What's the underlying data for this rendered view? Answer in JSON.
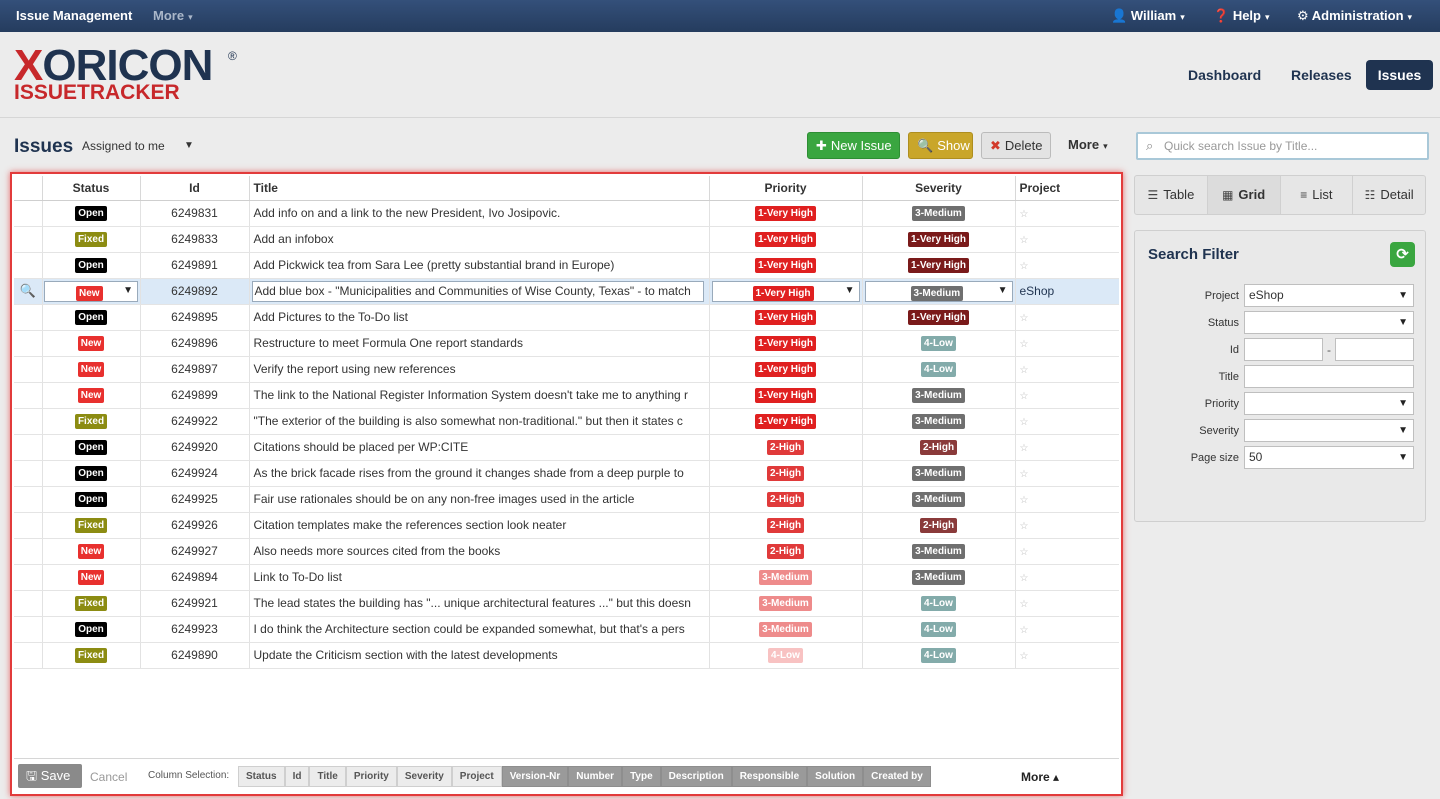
{
  "topbar": {
    "brand": "Issue Management",
    "more": "More",
    "user": "William",
    "help": "Help",
    "admin": "Administration"
  },
  "logo": {
    "line1": "XORICON",
    "line2": "ISSUETRACKER",
    "reg": "®"
  },
  "nav": {
    "dashboard": "Dashboard",
    "releases": "Releases",
    "issues": "Issues"
  },
  "toolbar": {
    "title": "Issues",
    "filter_select": "Assigned to me",
    "new_issue": "New Issue",
    "show": "Show",
    "delete": "Delete",
    "more": "More"
  },
  "search": {
    "placeholder": "Quick search Issue by Title..."
  },
  "grid": {
    "columns": {
      "status": "Status",
      "id": "Id",
      "title": "Title",
      "priority": "Priority",
      "severity": "Severity",
      "project": "Project"
    },
    "rows": [
      {
        "status": "Open",
        "id": "6249831",
        "title": "Add info on and a link to the new President, Ivo Josipovic.",
        "priority": "1-Very High",
        "severity": "3-Medium",
        "project": "☆"
      },
      {
        "status": "Fixed",
        "id": "6249833",
        "title": "Add an infobox",
        "priority": "1-Very High",
        "severity": "1-Very High",
        "project": "☆"
      },
      {
        "status": "Open",
        "id": "6249891",
        "title": "Add Pickwick tea from Sara Lee (pretty substantial brand in Europe)",
        "priority": "1-Very High",
        "severity": "1-Very High",
        "project": "☆"
      },
      {
        "status": "New",
        "id": "6249892",
        "title": "Add blue box - \"Municipalities and Communities of Wise County, Texas\" - to match",
        "priority": "1-Very High",
        "severity": "3-Medium",
        "project": "eShop"
      },
      {
        "status": "Open",
        "id": "6249895",
        "title": "Add Pictures to the To-Do list",
        "priority": "1-Very High",
        "severity": "1-Very High",
        "project": "☆"
      },
      {
        "status": "New",
        "id": "6249896",
        "title": "Restructure to meet Formula One report standards",
        "priority": "1-Very High",
        "severity": "4-Low",
        "project": "☆"
      },
      {
        "status": "New",
        "id": "6249897",
        "title": "Verify the report using new references",
        "priority": "1-Very High",
        "severity": "4-Low",
        "project": "☆"
      },
      {
        "status": "New",
        "id": "6249899",
        "title": "The link to the National Register Information System doesn't take me to anything r",
        "priority": "1-Very High",
        "severity": "3-Medium",
        "project": "☆"
      },
      {
        "status": "Fixed",
        "id": "6249922",
        "title": "\"The exterior of the building is also somewhat non-traditional.\" but then it states c",
        "priority": "1-Very High",
        "severity": "3-Medium",
        "project": "☆"
      },
      {
        "status": "Open",
        "id": "6249920",
        "title": "Citations should be placed per WP:CITE",
        "priority": "2-High",
        "severity": "2-High",
        "project": "☆"
      },
      {
        "status": "Open",
        "id": "6249924",
        "title": "As the brick facade rises from the ground it changes shade from a deep purple to",
        "priority": "2-High",
        "severity": "3-Medium",
        "project": "☆"
      },
      {
        "status": "Open",
        "id": "6249925",
        "title": "Fair use rationales should be on any non-free images used in the article",
        "priority": "2-High",
        "severity": "3-Medium",
        "project": "☆"
      },
      {
        "status": "Fixed",
        "id": "6249926",
        "title": "Citation templates make the references section look neater",
        "priority": "2-High",
        "severity": "2-High",
        "project": "☆"
      },
      {
        "status": "New",
        "id": "6249927",
        "title": "Also needs more sources cited from the books",
        "priority": "2-High",
        "severity": "3-Medium",
        "project": "☆"
      },
      {
        "status": "New",
        "id": "6249894",
        "title": "Link to To-Do list",
        "priority": "3-Medium",
        "severity": "3-Medium",
        "project": "☆"
      },
      {
        "status": "Fixed",
        "id": "6249921",
        "title": "The lead states the building has \"... unique architectural features ...\" but this doesn",
        "priority": "3-Medium",
        "severity": "4-Low",
        "project": "☆"
      },
      {
        "status": "Open",
        "id": "6249923",
        "title": "I do think the Architecture section could be expanded somewhat, but that's a pers",
        "priority": "3-Medium",
        "severity": "4-Low",
        "project": "☆"
      },
      {
        "status": "Fixed",
        "id": "6249890",
        "title": "Update the Criticism section with the latest developments",
        "priority": "4-Low",
        "severity": "4-Low",
        "project": "☆"
      }
    ]
  },
  "footer": {
    "save": "Save",
    "cancel": "Cancel",
    "column_selection": "Column Selection:",
    "columns": [
      "Status",
      "Id",
      "Title",
      "Priority",
      "Severity",
      "Project",
      "Version-Nr",
      "Number",
      "Type",
      "Description",
      "Responsible",
      "Solution",
      "Created by"
    ],
    "more": "More"
  },
  "views": {
    "table": "Table",
    "grid": "Grid",
    "list": "List",
    "detail": "Detail"
  },
  "filter": {
    "title": "Search Filter",
    "labels": {
      "project": "Project",
      "status": "Status",
      "id": "Id",
      "title": "Title",
      "priority": "Priority",
      "severity": "Severity",
      "page_size": "Page size"
    },
    "values": {
      "project": "eShop",
      "status": "",
      "id_from": "",
      "id_to": "",
      "title": "",
      "priority": "",
      "severity": "",
      "page_size": "50"
    }
  },
  "colors": {
    "accent": "#1f3350",
    "brand_red": "#c7282b",
    "new_button": "#3aa640",
    "show_button": "#c9a62a",
    "selection_border": "#e23b3b"
  }
}
